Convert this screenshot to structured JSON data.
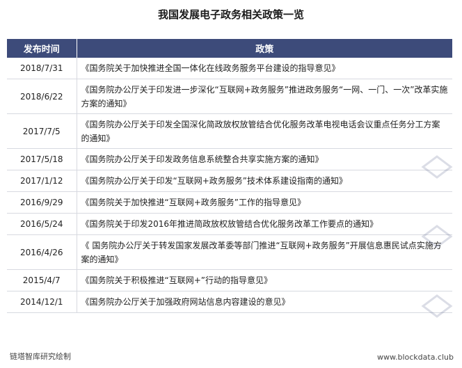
{
  "title": "我国发展电子政务相关政策一览",
  "table": {
    "headers": [
      "发布时间",
      "政策"
    ],
    "rows": [
      {
        "date": "2018/7/31",
        "policy": "《国务院关于加快推进全国一体化在线政务服务平台建设的指导意见》"
      },
      {
        "date": "2018/6/22",
        "policy": "《国务院办公厅关于印发进一步深化“互联网+政务服务”推进政务服务“一网、一门、一次”改革实施方案的通知》"
      },
      {
        "date": "2017/7/5",
        "policy": "《国务院办公厅关于印发全国深化简政放权放管结合优化服务改革电视电话会议重点任务分工方案的通知》"
      },
      {
        "date": "2017/5/18",
        "policy": "《国务院办公厅关于印发政务信息系统整合共享实施方案的通知》"
      },
      {
        "date": "2017/1/12",
        "policy": "《国务院办公厅关于印发“互联网+政务服务”技术体系建设指南的通知》"
      },
      {
        "date": "2016/9/29",
        "policy": "《国务院关于加快推进“互联网+政务服务”工作的指导意见》"
      },
      {
        "date": "2016/5/24",
        "policy": "《国务院关于印发2016年推进简政放权放管结合优化服务改革工作要点的通知》"
      },
      {
        "date": "2016/4/26",
        "policy": "《 国务院办公厅关于转发国家发展改革委等部门推进“互联网+政务服务”开展信息惠民试点实施方案的通知》"
      },
      {
        "date": "2015/4/7",
        "policy": "《国务院关于积极推进“互联网+”行动的指导意见》"
      },
      {
        "date": "2014/12/1",
        "policy": "《国务院办公厅关于加强政府网站信息内容建设的意见》"
      }
    ]
  },
  "footer": {
    "source": "链塔智库研究绘制",
    "site": "www.blockdata.club"
  },
  "colors": {
    "header_bg": "#3d4b7a",
    "border": "#d7d9e0"
  }
}
